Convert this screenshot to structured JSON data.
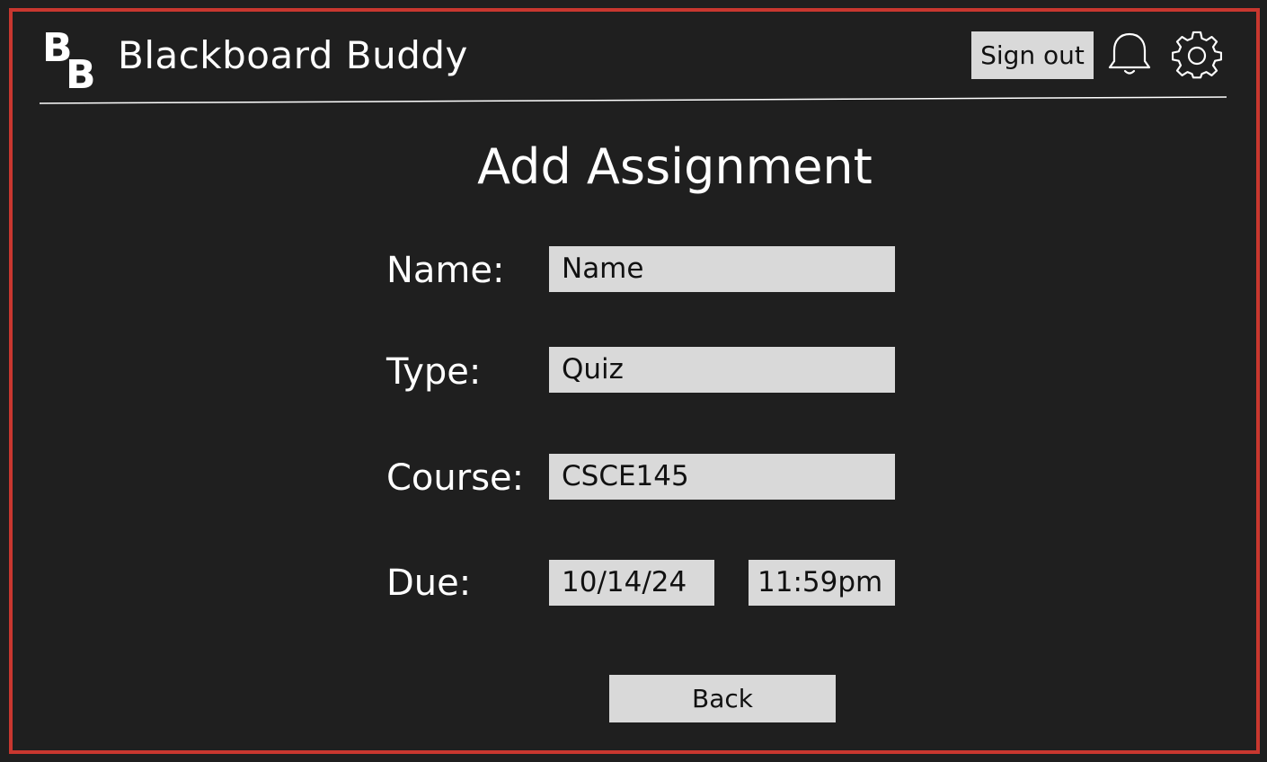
{
  "app": {
    "title": "Blackboard Buddy",
    "logo_letters": "BB",
    "logo_icon": "bb-logo-icon"
  },
  "header": {
    "sign_out_label": "Sign out",
    "notification_icon": "bell-icon",
    "settings_icon": "gear-icon"
  },
  "page": {
    "title": "Add Assignment"
  },
  "form": {
    "name_label": "Name:",
    "name_value": "Name",
    "type_label": "Type:",
    "type_value": "Quiz",
    "course_label": "Course:",
    "course_value": "CSCE145",
    "due_label": "Due:",
    "due_date": "10/14/24",
    "due_time": "11:59pm"
  },
  "actions": {
    "back_label": "Back"
  },
  "colors": {
    "background": "#1f1f1f",
    "frame_border": "#c8372f",
    "field_background": "#d9d9d9",
    "text": "#ffffff"
  }
}
